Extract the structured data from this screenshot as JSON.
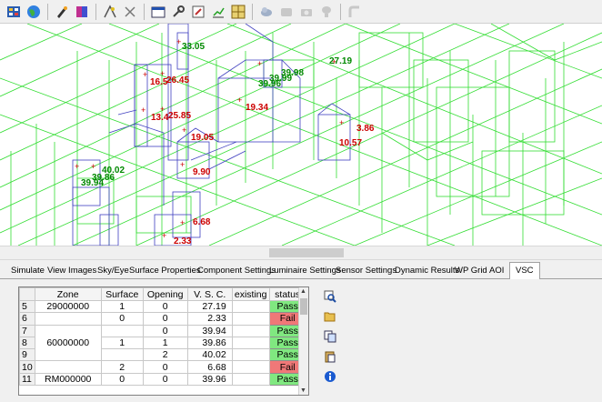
{
  "toolbar": {
    "icons": [
      "grid-view-icon",
      "globe-icon",
      "pen-tool-icon",
      "palette-icon",
      "sky-icon",
      "cursor-icon",
      "window-icon",
      "wrench-icon",
      "edit-icon",
      "chart-icon",
      "grid-settings-icon",
      "cloud-icon",
      "sensor-gray-icon",
      "camera-gray-icon",
      "lamp-gray-icon"
    ]
  },
  "viewport": {
    "labels": [
      {
        "text": "33.05",
        "color": "green"
      },
      {
        "text": "16.5",
        "color": "red"
      },
      {
        "text": "26.45",
        "color": "red"
      },
      {
        "text": "39.98",
        "color": "green"
      },
      {
        "text": "27.19",
        "color": "green"
      },
      {
        "text": "39.99",
        "color": "green"
      },
      {
        "text": "39.96",
        "color": "green"
      },
      {
        "text": "19.34",
        "color": "red"
      },
      {
        "text": "13.4",
        "color": "red"
      },
      {
        "text": "25.85",
        "color": "red"
      },
      {
        "text": "3.86",
        "color": "red"
      },
      {
        "text": "19.05",
        "color": "red"
      },
      {
        "text": "10.57",
        "color": "red"
      },
      {
        "text": "40.02",
        "color": "green"
      },
      {
        "text": "39.86",
        "color": "green"
      },
      {
        "text": "39.94",
        "color": "green"
      },
      {
        "text": "9.90",
        "color": "red"
      },
      {
        "text": "6.68",
        "color": "red"
      },
      {
        "text": "2.33",
        "color": "red"
      }
    ]
  },
  "tabs": [
    "Simulate",
    "View Images",
    "Sky/Eye",
    "Surface Properties",
    "Component Settings",
    "Luminaire Settings",
    "Sensor Settings",
    "Dynamic Results",
    "WP Grid",
    "AOI",
    "VSC"
  ],
  "active_tab": "VSC",
  "table": {
    "headers": [
      "",
      "Zone",
      "Surface",
      "Opening",
      "V. S. C.",
      "existing",
      "status"
    ],
    "rows": [
      {
        "n": "5",
        "zone": "29000000",
        "surface": "1",
        "opening": "0",
        "vsc": "27.19",
        "existing": "",
        "status": "Pass"
      },
      {
        "n": "6",
        "zone": "",
        "surface": "0",
        "opening": "0",
        "vsc": "2.33",
        "existing": "",
        "status": "Fail"
      },
      {
        "n": "7",
        "zone": "",
        "surface": "",
        "opening": "0",
        "vsc": "39.94",
        "existing": "",
        "status": "Pass"
      },
      {
        "n": "8",
        "zone": "60000000",
        "surface": "1",
        "opening": "1",
        "vsc": "39.86",
        "existing": "",
        "status": "Pass"
      },
      {
        "n": "9",
        "zone": "",
        "surface": "",
        "opening": "2",
        "vsc": "40.02",
        "existing": "",
        "status": "Pass"
      },
      {
        "n": "10",
        "zone": "",
        "surface": "2",
        "opening": "0",
        "vsc": "6.68",
        "existing": "",
        "status": "Fail"
      },
      {
        "n": "11",
        "zone": "RM000000",
        "surface": "0",
        "opening": "0",
        "vsc": "39.96",
        "existing": "",
        "status": "Pass"
      }
    ]
  },
  "side_buttons": [
    "search-grid-icon",
    "open-folder-icon",
    "copy-icon",
    "paste-icon",
    "info-icon"
  ],
  "colors": {
    "pass": "#80e880",
    "fail": "#f07878",
    "wire_green": "#33dd33",
    "wire_blue": "#4040c0",
    "label_red": "#cc0000",
    "label_green": "#008800"
  }
}
